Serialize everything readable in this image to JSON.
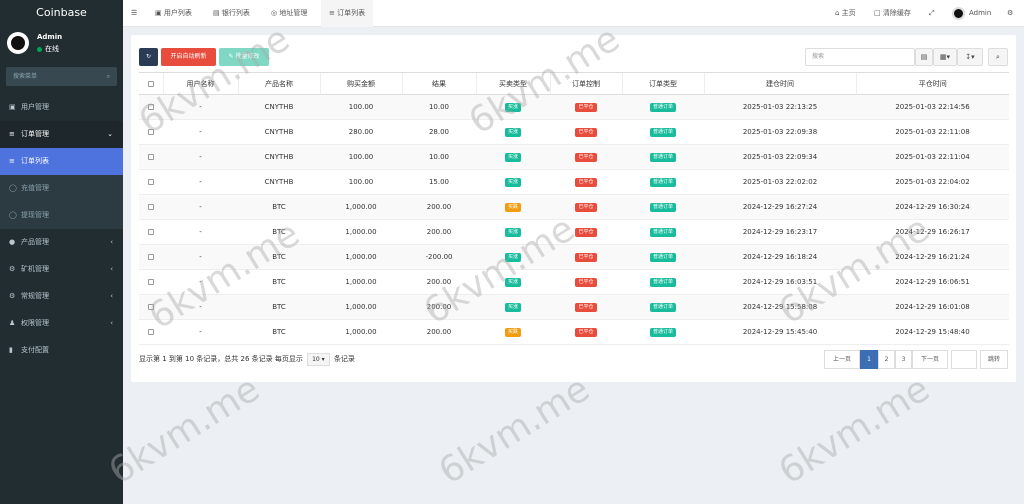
{
  "sidebar": {
    "brand": "Coinbase",
    "user_name": "Admin",
    "user_status": "在线",
    "search_placeholder": "搜索菜单",
    "items": [
      {
        "label": "用户管理",
        "icon": "user-icon"
      },
      {
        "label": "订单管理",
        "icon": "list-icon"
      },
      {
        "label": "订单列表",
        "icon": "list-icon"
      },
      {
        "label": "充值管理",
        "icon": "circle-icon"
      },
      {
        "label": "提现管理",
        "icon": "circle-icon"
      },
      {
        "label": "产品管理",
        "icon": "product-icon"
      },
      {
        "label": "矿机管理",
        "icon": "miner-icon"
      },
      {
        "label": "常规管理",
        "icon": "cogs-icon"
      },
      {
        "label": "权限管理",
        "icon": "group-icon"
      },
      {
        "label": "支付配置",
        "icon": "pay-icon"
      }
    ]
  },
  "topbar": {
    "tabs": [
      "用户列表",
      "银行列表",
      "地址管理",
      "订单列表"
    ],
    "home": "主页",
    "clear_cache": "清除缓存",
    "admin": "Admin"
  },
  "toolbar": {
    "auto_refresh": "开启自动刷新",
    "batch_edit": "批量修改",
    "search_placeholder": "搜索"
  },
  "table": {
    "headers": [
      "用户名称",
      "产品名称",
      "购买金额",
      "结果",
      "买卖类型",
      "订单控制",
      "订单类型",
      "建仓时间",
      "平仓时间"
    ],
    "rows": [
      {
        "user": "-",
        "product": "CNYTHB",
        "amount": "100.00",
        "result": "10.00",
        "trade": "买涨",
        "trade_color": "green",
        "control": "已平仓",
        "type": "普通订单",
        "open": "2025-01-03 22:13:25",
        "close": "2025-01-03 22:14:56"
      },
      {
        "user": "-",
        "product": "CNYTHB",
        "amount": "280.00",
        "result": "28.00",
        "trade": "买涨",
        "trade_color": "green",
        "control": "已平仓",
        "type": "普通订单",
        "open": "2025-01-03 22:09:38",
        "close": "2025-01-03 22:11:08"
      },
      {
        "user": "-",
        "product": "CNYTHB",
        "amount": "100.00",
        "result": "10.00",
        "trade": "买涨",
        "trade_color": "green",
        "control": "已平仓",
        "type": "普通订单",
        "open": "2025-01-03 22:09:34",
        "close": "2025-01-03 22:11:04"
      },
      {
        "user": "-",
        "product": "CNYTHB",
        "amount": "100.00",
        "result": "15.00",
        "trade": "买涨",
        "trade_color": "green",
        "control": "已平仓",
        "type": "普通订单",
        "open": "2025-01-03 22:02:02",
        "close": "2025-01-03 22:04:02"
      },
      {
        "user": "-",
        "product": "BTC",
        "amount": "1,000.00",
        "result": "200.00",
        "trade": "买跌",
        "trade_color": "orange",
        "control": "已平仓",
        "type": "普通订单",
        "open": "2024-12-29 16:27:24",
        "close": "2024-12-29 16:30:24"
      },
      {
        "user": "-",
        "product": "BTC",
        "amount": "1,000.00",
        "result": "200.00",
        "trade": "买涨",
        "trade_color": "green",
        "control": "已平仓",
        "type": "普通订单",
        "open": "2024-12-29 16:23:17",
        "close": "2024-12-29 16:26:17"
      },
      {
        "user": "-",
        "product": "BTC",
        "amount": "1,000.00",
        "result": "-200.00",
        "trade": "买涨",
        "trade_color": "green",
        "control": "已平仓",
        "type": "普通订单",
        "open": "2024-12-29 16:18:24",
        "close": "2024-12-29 16:21:24"
      },
      {
        "user": "-",
        "product": "BTC",
        "amount": "1,000.00",
        "result": "200.00",
        "trade": "买涨",
        "trade_color": "green",
        "control": "已平仓",
        "type": "普通订单",
        "open": "2024-12-29 16:03:51",
        "close": "2024-12-29 16:06:51"
      },
      {
        "user": "-",
        "product": "BTC",
        "amount": "1,000.00",
        "result": "200.00",
        "trade": "买涨",
        "trade_color": "green",
        "control": "已平仓",
        "type": "普通订单",
        "open": "2024-12-29 15:58:08",
        "close": "2024-12-29 16:01:08"
      },
      {
        "user": "-",
        "product": "BTC",
        "amount": "1,000.00",
        "result": "200.00",
        "trade": "买跌",
        "trade_color": "orange",
        "control": "已平仓",
        "type": "普通订单",
        "open": "2024-12-29 15:45:40",
        "close": "2024-12-29 15:48:40"
      }
    ]
  },
  "footer": {
    "info_prefix": "显示第 1 到第 10 条记录，总共 26 条记录 每页显示",
    "page_size": "10",
    "info_suffix": "条记录",
    "prev": "上一页",
    "pages": [
      "1",
      "2",
      "3"
    ],
    "next": "下一页",
    "jump": "跳转"
  },
  "watermark": "6kvm.me",
  "colors": {
    "sidebar_bg": "#222d32",
    "active_menu": "#4e73df",
    "badge_green": "#18bc9c",
    "badge_orange": "#f39c12",
    "badge_red": "#e74c3c"
  }
}
